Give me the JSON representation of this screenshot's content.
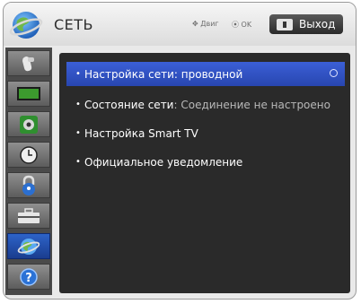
{
  "header": {
    "title": "СЕТЬ",
    "hint_move": "Двиг",
    "hint_ok": "OK",
    "exit_label": "Выход"
  },
  "sidebar": {
    "items": [
      {
        "icon": "picture-settings-icon",
        "active": false
      },
      {
        "icon": "screen-icon",
        "active": false
      },
      {
        "icon": "audio-icon",
        "active": false
      },
      {
        "icon": "clock-icon",
        "active": false
      },
      {
        "icon": "lock-icon",
        "active": false
      },
      {
        "icon": "options-icon",
        "active": false
      },
      {
        "icon": "network-globe-icon",
        "active": true
      },
      {
        "icon": "help-icon",
        "active": false
      }
    ]
  },
  "menu": {
    "items": [
      {
        "label": "Настройка сети: проводной",
        "value": "",
        "selected": true
      },
      {
        "label": "Состояние сети",
        "value": ": Соединение не настроено",
        "selected": false
      },
      {
        "label": "Настройка Smart TV",
        "value": "",
        "selected": false
      },
      {
        "label": "Официальное уведомление",
        "value": "",
        "selected": false
      }
    ]
  },
  "colors": {
    "selected_bg": "#3b5fd6",
    "content_bg": "#2a2a2a",
    "sidebar_active": "#2d63c8"
  }
}
